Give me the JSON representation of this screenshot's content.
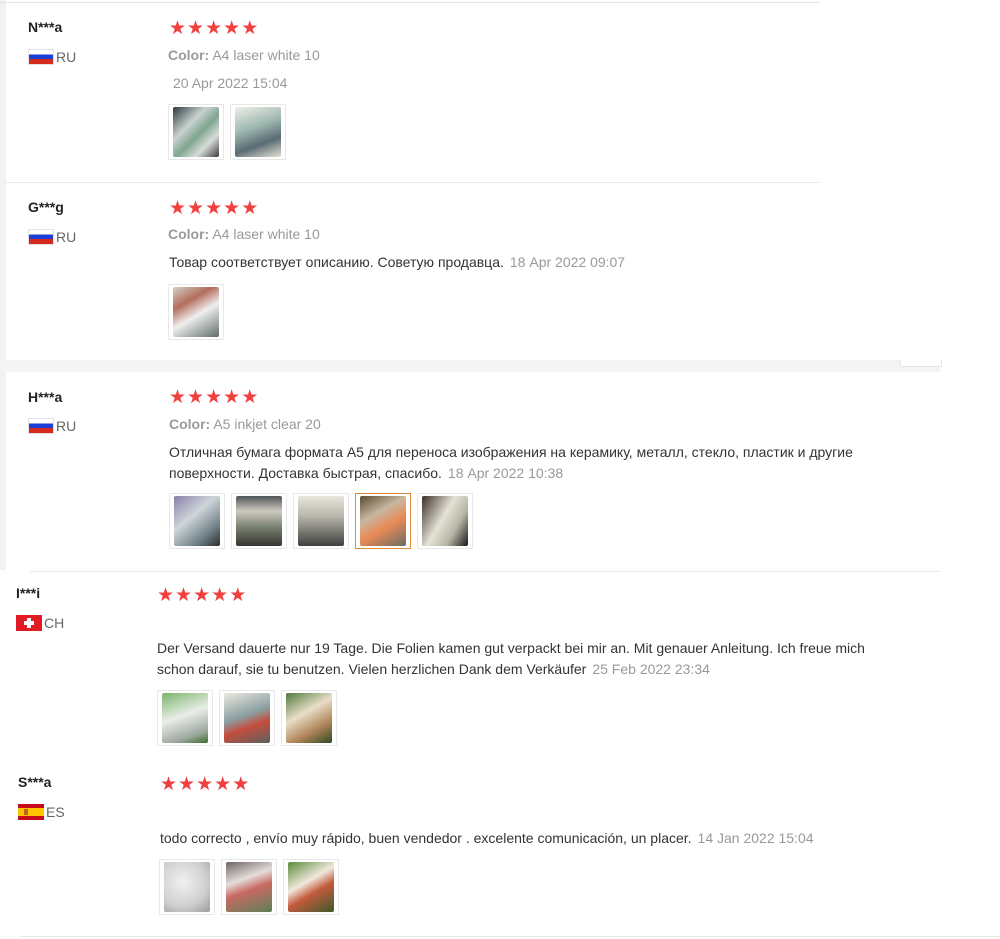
{
  "reviews": [
    {
      "name": "N***a",
      "country": "RU",
      "rating": 5,
      "color_label": "Color:",
      "color_value": "A4 laser white 10",
      "date": "20 Apr 2022 15:04",
      "photos": 2
    },
    {
      "name": "G***g",
      "country": "RU",
      "rating": 5,
      "color_label": "Color:",
      "color_value": "A4 laser white 10",
      "text": "Товар соответствует описанию. Советую продавца.",
      "date": "18 Apr 2022 09:07",
      "photos": 1
    },
    {
      "name": "H***a",
      "country": "RU",
      "rating": 5,
      "color_label": "Color:",
      "color_value": "A5 inkjet clear 20",
      "text_line1": "Отличная бумага формата А5 для переноса изображения на керамику, металл, стекло, пластик и другие",
      "text_line2": "поверхности. Доставка быстрая, спасибо.",
      "date": "18 Apr 2022 10:38",
      "photos": 5,
      "selected_photo": 4
    },
    {
      "name": "I***i",
      "country": "CH",
      "rating": 5,
      "text_line1": "Der Versand dauerte nur 19 Tage. Die Folien kamen gut verpackt bei mir an. Mit genauer Anleitung. Ich freue mich",
      "text_line2": "schon darauf, sie tu benutzen. Vielen herzlichen Dank dem Verkäufer",
      "date": "25 Feb 2022 23:34",
      "photos": 3
    },
    {
      "name": "S***a",
      "country": "ES",
      "rating": 5,
      "text": "todo correcto , envío muy rápido, buen vendedor . excelente comunicación, un placer.",
      "date": "14 Jan 2022 15:04",
      "photos": 3
    }
  ],
  "icons": {
    "star": "★",
    "flag_ru": "flag-ru-icon",
    "flag_ch": "flag-ch-icon",
    "flag_es": "flag-es-icon"
  },
  "colors": {
    "star": "#f04040",
    "selected_thumb_border": "#e08a3c"
  }
}
